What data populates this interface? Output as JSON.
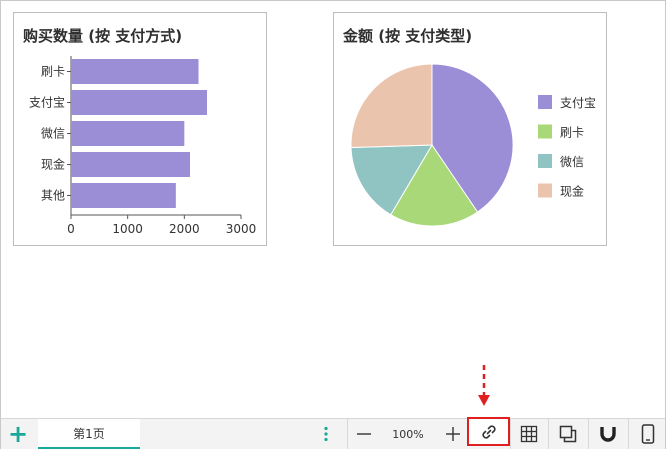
{
  "chart_left": {
    "title": "购买数量 (按 支付方式)",
    "chart_data": {
      "type": "bar",
      "orientation": "horizontal",
      "title": "购买数量 (按 支付方式)",
      "categories": [
        "刷卡",
        "支付宝",
        "微信",
        "现金",
        "其他"
      ],
      "values": [
        2250,
        2400,
        2000,
        2100,
        1850
      ],
      "xlim": [
        0,
        3000
      ],
      "xticks": [
        "0",
        "1000",
        "2000",
        "3000"
      ],
      "color": "#9b8dd6"
    }
  },
  "chart_right": {
    "title": "金额 (按 支付类型)",
    "chart_data": {
      "type": "pie",
      "title": "金额 (按 支付类型)",
      "labels": [
        "支付宝",
        "刷卡",
        "微信",
        "现金"
      ],
      "values": [
        40.5,
        18,
        16,
        25.5
      ],
      "colors": [
        "#9b8dd6",
        "#a8d877",
        "#8fc4c3",
        "#ebc4ad"
      ],
      "legend_position": "right"
    }
  },
  "bottom_bar": {
    "add_icon": "plus-icon",
    "sheet_tab_label": "第1页",
    "more_icon": "vertical-dots-icon",
    "zoom_out_label": "—",
    "zoom_value": "100%",
    "zoom_in_label": "+",
    "link_icon": "link-icon",
    "tools": [
      "grid-icon",
      "layers-icon",
      "magnet-icon",
      "mobile-icon"
    ],
    "accent_color": "#1aa89a",
    "highlight_color": "#e02020"
  }
}
